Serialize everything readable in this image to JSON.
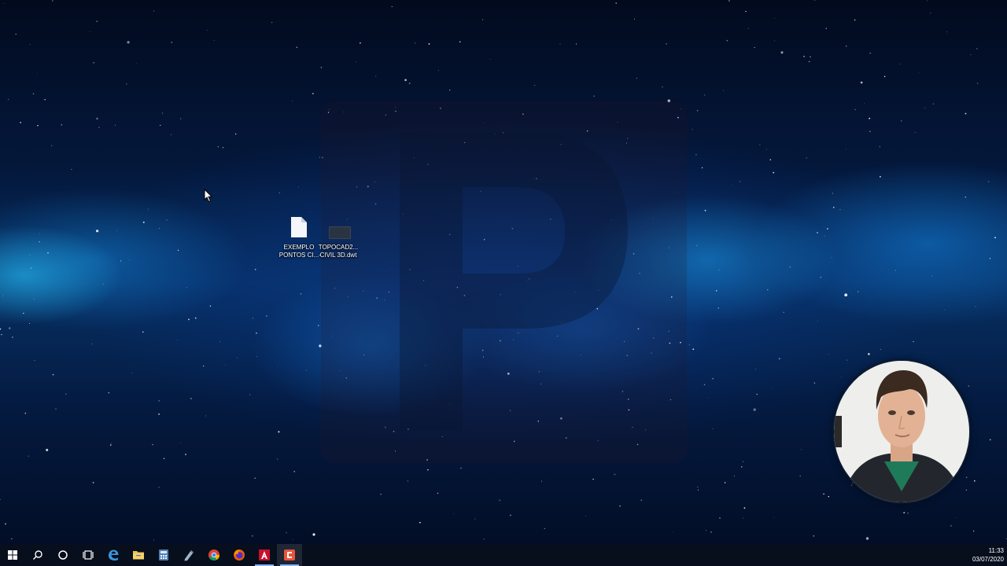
{
  "desktop": {
    "icons": [
      {
        "name": "EXEMPLO PONTOS CI...",
        "line1": "EXEMPLO",
        "line2": "PONTOS CI...",
        "type": "document-icon"
      },
      {
        "name": "TOPOCAD2... CIVIL 3D.dwt",
        "line1": "TOPOCAD2...",
        "line2": "CIVIL 3D.dwt",
        "type": "dwt-file-icon"
      }
    ],
    "watermark_logo": "P"
  },
  "taskbar": {
    "items": [
      {
        "name": "start-button",
        "icon": "windows-logo-icon"
      },
      {
        "name": "search-button",
        "icon": "search-icon"
      },
      {
        "name": "cortana-button",
        "icon": "circle-icon"
      },
      {
        "name": "task-view-button",
        "icon": "task-view-icon"
      },
      {
        "name": "edge-button",
        "icon": "edge-icon"
      },
      {
        "name": "file-explorer-button",
        "icon": "folder-icon"
      },
      {
        "name": "calculator-button",
        "icon": "calculator-icon"
      },
      {
        "name": "notepad-button",
        "icon": "notepad-icon"
      },
      {
        "name": "chrome-button",
        "icon": "chrome-icon"
      },
      {
        "name": "firefox-button",
        "icon": "firefox-icon"
      },
      {
        "name": "autocad-button",
        "icon": "autocad-icon"
      },
      {
        "name": "camtasia-button",
        "icon": "camtasia-icon"
      }
    ],
    "clock": {
      "time": "11:33",
      "date": "03/07/2020"
    }
  },
  "colors": {
    "taskbar_bg": "#080e1c",
    "autocad_red": "#c8102e",
    "camtasia_orange": "#e8553b",
    "active_indicator": "#7fb8ff"
  }
}
